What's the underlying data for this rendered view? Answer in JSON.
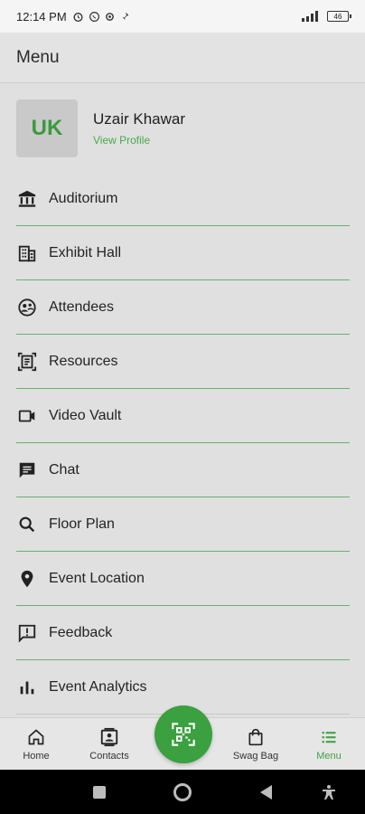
{
  "status_bar": {
    "time": "12:14 PM",
    "battery": "46"
  },
  "header": {
    "title": "Menu"
  },
  "profile": {
    "initials": "UK",
    "name": "Uzair Khawar",
    "link": "View Profile"
  },
  "menu": [
    {
      "label": "Auditorium",
      "icon": "bank-icon"
    },
    {
      "label": "Exhibit Hall",
      "icon": "building-icon"
    },
    {
      "label": "Attendees",
      "icon": "attendees-icon"
    },
    {
      "label": "Resources",
      "icon": "document-scan-icon"
    },
    {
      "label": "Video Vault",
      "icon": "videocam-icon"
    },
    {
      "label": "Chat",
      "icon": "chat-icon"
    },
    {
      "label": "Floor Plan",
      "icon": "search-icon"
    },
    {
      "label": "Event Location",
      "icon": "location-pin-icon"
    },
    {
      "label": "Feedback",
      "icon": "feedback-icon"
    },
    {
      "label": "Event Analytics",
      "icon": "bar-chart-icon"
    }
  ],
  "bottom_nav": {
    "home": "Home",
    "contacts": "Contacts",
    "swag_bag": "Swag Bag",
    "menu": "Menu"
  },
  "colors": {
    "accent": "#3aa040",
    "divider": "#6ab06e",
    "background": "#e0e0e0"
  }
}
